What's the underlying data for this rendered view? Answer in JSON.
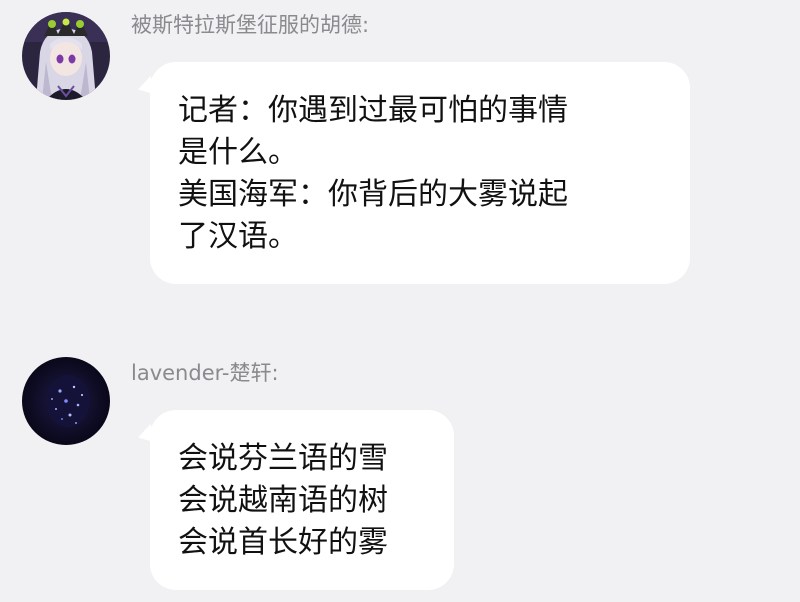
{
  "colors": {
    "background": "#f1f1f3",
    "bubble": "#ffffff",
    "name_text": "#8a8a8e",
    "message_text": "#111111"
  },
  "messages": [
    {
      "sender": "被斯特拉斯堡征服的胡德:",
      "avatar_icon": "anime-girl-avatar-icon",
      "lines": [
        "记者：你遇到过最可怕的事情",
        "是什么。",
        "美国海军：你背后的大雾说起",
        "了汉语。"
      ]
    },
    {
      "sender": "lavender-楚轩:",
      "avatar_icon": "starry-night-avatar-icon",
      "lines": [
        "会说芬兰语的雪",
        "会说越南语的树",
        "会说首长好的雾"
      ]
    }
  ]
}
